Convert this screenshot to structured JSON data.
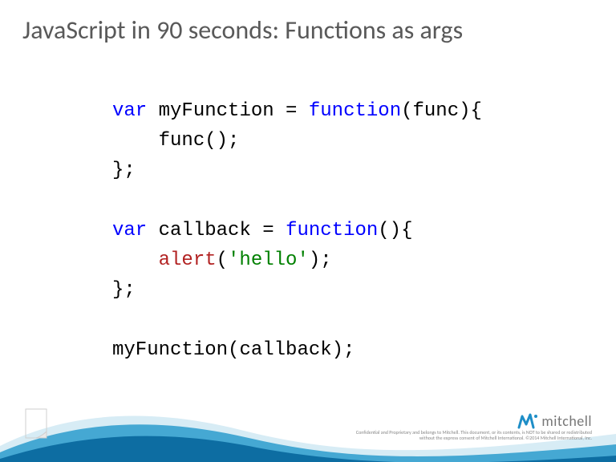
{
  "title": "JavaScript in 90 seconds: Functions as args",
  "code": {
    "l1": {
      "var": "var",
      "name": "myFunction",
      "eq": " = ",
      "func": "function",
      "paramsOpen": "(",
      "param": "func",
      "paramsClose": "){"
    },
    "l2": {
      "indent": "    ",
      "call": "func",
      "after": "();"
    },
    "l3": "};",
    "l4": "",
    "l5": {
      "var": "var",
      "name": "callback",
      "eq": " = ",
      "func": "function",
      "parens": "(){"
    },
    "l6": {
      "indent": "    ",
      "alert": "alert",
      "open": "(",
      "str": "'hello'",
      "close": ");"
    },
    "l7": "};",
    "l8": "",
    "l9": {
      "call": "myFunction",
      "open": "(",
      "arg": "callback",
      "close": ");"
    }
  },
  "logo": {
    "text": "mitchell"
  },
  "disclaimer": "Confidential and Proprietary and belongs to Mitchell. This document, or its contents, is NOT to be shared or redistributed without the express consent of Mitchell International. ©2014 Mitchell International, Inc."
}
